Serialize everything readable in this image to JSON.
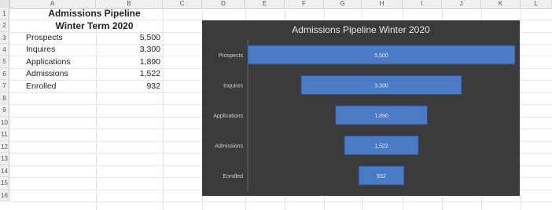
{
  "sheet": {
    "columns": [
      "A",
      "B",
      "C",
      "D",
      "E",
      "F",
      "G",
      "H",
      "I",
      "J",
      "K",
      "L"
    ],
    "rows": [
      "1",
      "2",
      "3",
      "4",
      "5",
      "6",
      "7",
      "8",
      "9",
      "10",
      "11",
      "12",
      "13",
      "14",
      "15",
      "16"
    ],
    "title_line1": "Admissions Pipeline",
    "title_line2": "Winter Term 2020",
    "data": [
      {
        "label": "Prospects",
        "value": "5,500"
      },
      {
        "label": "Inquires",
        "value": "3,300"
      },
      {
        "label": "Applications",
        "value": "1,890"
      },
      {
        "label": "Admissions",
        "value": "1,522"
      },
      {
        "label": "Enrolled",
        "value": "932"
      }
    ]
  },
  "chart_data": {
    "type": "bar",
    "title": "Admissions Pipeline Winter 2020",
    "categories": [
      "Prospects",
      "Inquires",
      "Applications",
      "Admissions",
      "Enrolled"
    ],
    "values": [
      5500,
      3300,
      1890,
      1522,
      932
    ],
    "data_labels": [
      "5,500",
      "3,300",
      "1,890",
      "1,522",
      "932"
    ],
    "orientation": "horizontal-funnel",
    "xlim": [
      0,
      5500
    ],
    "grid": false,
    "legend": "none"
  },
  "colors": {
    "chart_bg": "#3b3b3b",
    "bar": "#4a7bc4",
    "bar_edge": "#2b4f8a",
    "chart_text": "#e6e6e6"
  }
}
